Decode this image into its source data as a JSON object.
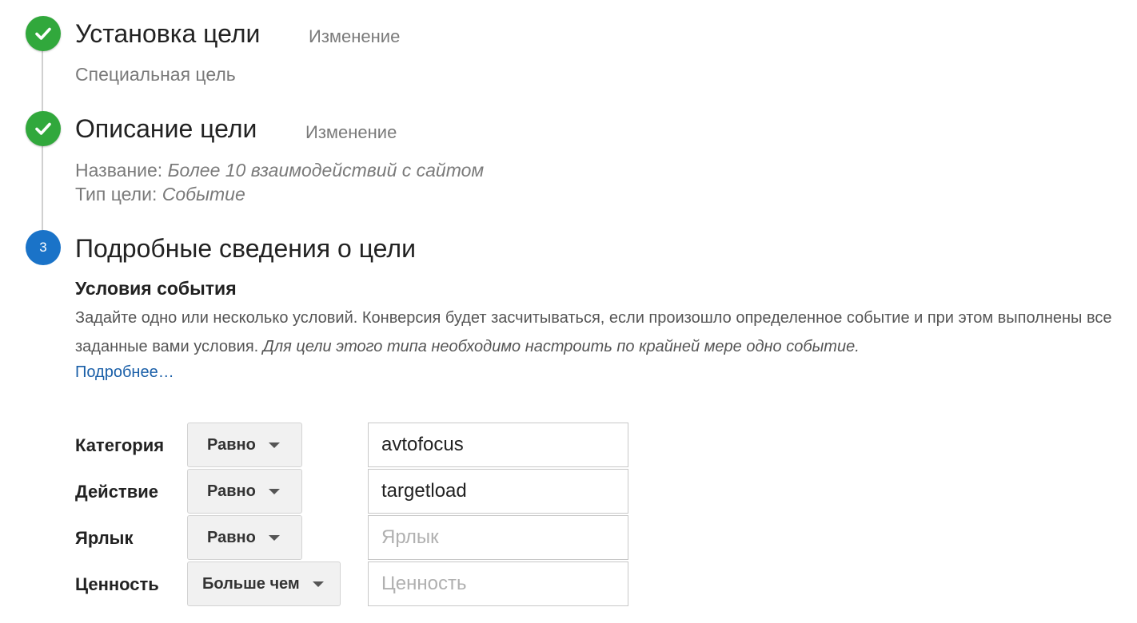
{
  "steps": [
    {
      "number": "",
      "status": "done",
      "title": "Установка цели",
      "edit_label": "Изменение",
      "summary": "Специальная цель"
    },
    {
      "number": "",
      "status": "done",
      "title": "Описание цели",
      "edit_label": "Изменение",
      "name_label": "Название:",
      "name_value": "Более 10 взаимодействий с сайтом",
      "type_label": "Тип цели:",
      "type_value": "Событие"
    },
    {
      "number": "3",
      "status": "active",
      "title": "Подробные сведения о цели"
    }
  ],
  "event_conditions": {
    "heading": "Условия события",
    "description": "Задайте одно или несколько условий. Конверсия будет засчитываться, если произошло определенное событие и при этом выполнены все заданные вами условия.",
    "description_note": "Для цели этого типа необходимо настроить по крайней мере одно событие.",
    "more_link": "Подробнее…",
    "rows": [
      {
        "label": "Категория",
        "operator": "Равно",
        "value": "avtofocus",
        "placeholder": ""
      },
      {
        "label": "Действие",
        "operator": "Равно",
        "value": "targetload",
        "placeholder": ""
      },
      {
        "label": "Ярлык",
        "operator": "Равно",
        "value": "",
        "placeholder": "Ярлык"
      },
      {
        "label": "Ценность",
        "operator": "Больше чем",
        "value": "",
        "placeholder": "Ценность"
      }
    ]
  },
  "icons": {
    "done": "check-icon",
    "active": "step-number"
  },
  "colors": {
    "done": "#31a83c",
    "active": "#1a73c8",
    "link": "#1a5fa8"
  }
}
